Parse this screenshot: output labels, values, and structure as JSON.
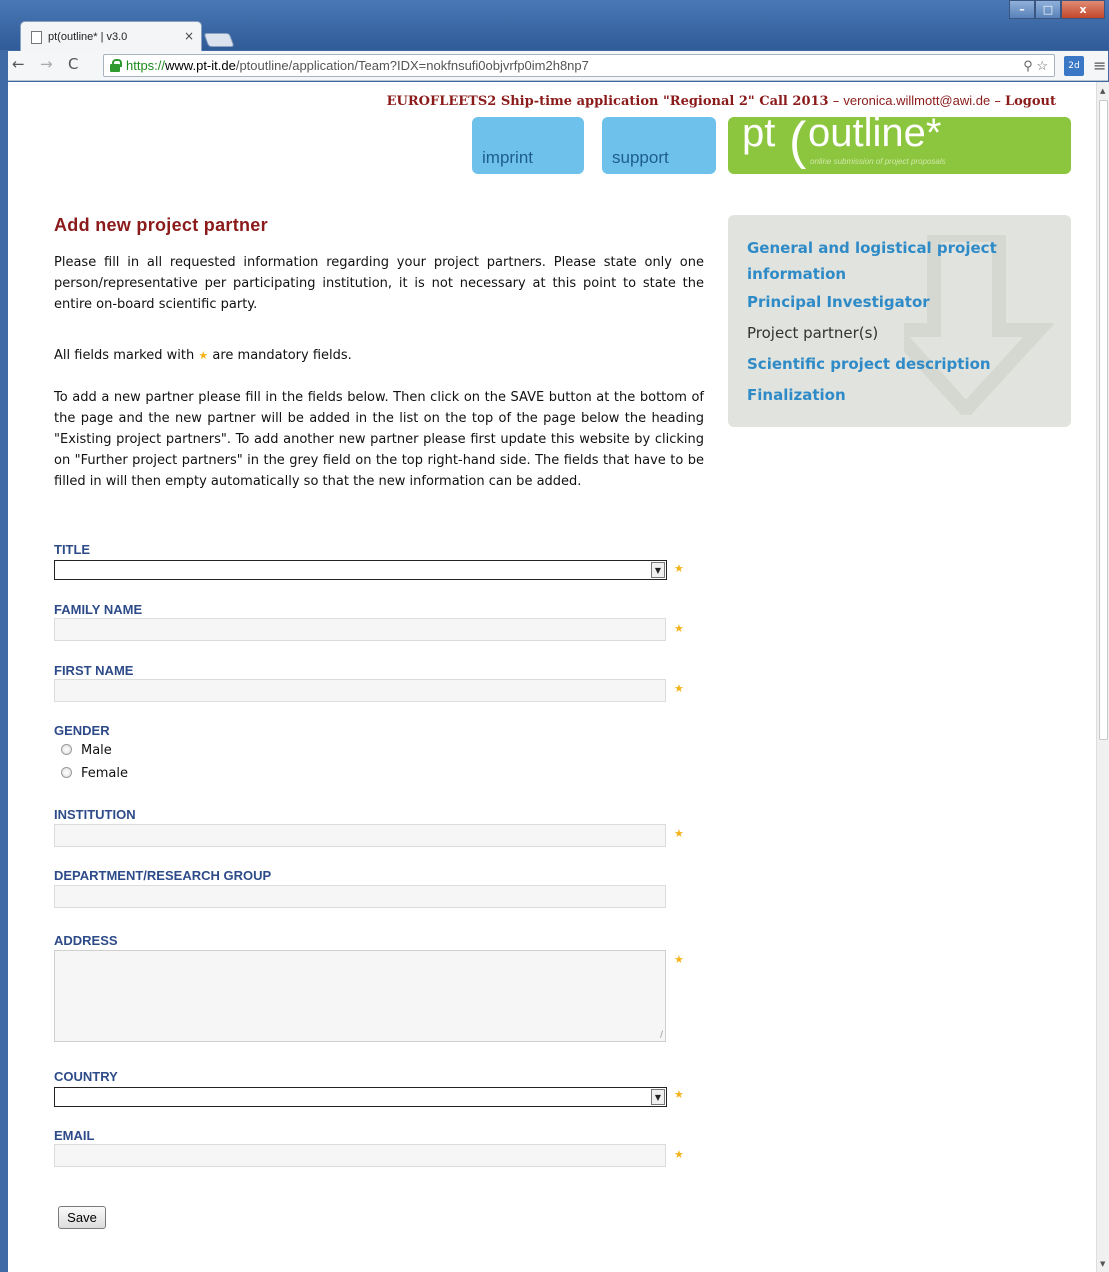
{
  "browser": {
    "tab_title": "pt(outline* | v3.0",
    "tab_close": "×",
    "url_protocol": "https://",
    "url_host": "www.pt-it.de",
    "url_path": "/ptoutline/application/Team?IDX=nokfnsufi0objvrfp0im2h8np7",
    "extension_badge": "2d",
    "window_minimize": "–",
    "window_maximize": "□",
    "window_close": "x"
  },
  "header": {
    "call_title": "EUROFLEETS2 Ship-time application \"Regional 2\" Call 2013",
    "separator": " – ",
    "user_email": "veronica.willmott@awi.de",
    "logout_label": "Logout",
    "nav_imprint": "imprint",
    "nav_support": "support",
    "logo_pt": "pt",
    "logo_outline": "outline*",
    "logo_tagline": "online submission of project proposals"
  },
  "main": {
    "heading": "Add new project partner",
    "intro": "Please fill in all requested information regarding your project partners. Please state only one person/representative per participating institution, it is not necessary at this point to state the entire on-board scientific party.",
    "mandatory_prefix": "All fields marked with",
    "mandatory_suffix": "are mandatory fields.",
    "instructions": "To add a new partner please fill in the fields below. Then click on the SAVE button at the bottom of the page and the new partner will be added in the list on the top of the page below the heading \"Existing project partners\". To add another new partner please first update this website by clicking on \"Further project partners\" in the grey field on the top right-hand side. The fields that have to be filled in will then empty automatically so that the new information can be added."
  },
  "sidebar": {
    "items": [
      {
        "label": "General and logistical project information"
      },
      {
        "label": "Principal Investigator"
      },
      {
        "label": "Project partner(s)"
      },
      {
        "label": "Scientific project description"
      },
      {
        "label": "Finalization"
      }
    ]
  },
  "form": {
    "title_label": "TITLE",
    "title_value": "",
    "family_name_label": "FAMILY NAME",
    "family_name_value": "",
    "first_name_label": "FIRST NAME",
    "first_name_value": "",
    "gender_label": "GENDER",
    "gender_options": [
      "Male",
      "Female"
    ],
    "institution_label": "INSTITUTION",
    "institution_value": "",
    "department_label": "DEPARTMENT/RESEARCH GROUP",
    "department_value": "",
    "address_label": "ADDRESS",
    "address_value": "",
    "country_label": "COUNTRY",
    "country_value": "",
    "email_label": "EMAIL",
    "email_value": "",
    "save_label": "Save"
  },
  "colors": {
    "accent_red": "#8b1a1a",
    "link_blue": "#2f8bc7",
    "label_blue": "#2e4b89",
    "logo_green": "#8cc63e",
    "nav_blue": "#6ec1ea",
    "mandatory_star": "#f5b31b"
  }
}
